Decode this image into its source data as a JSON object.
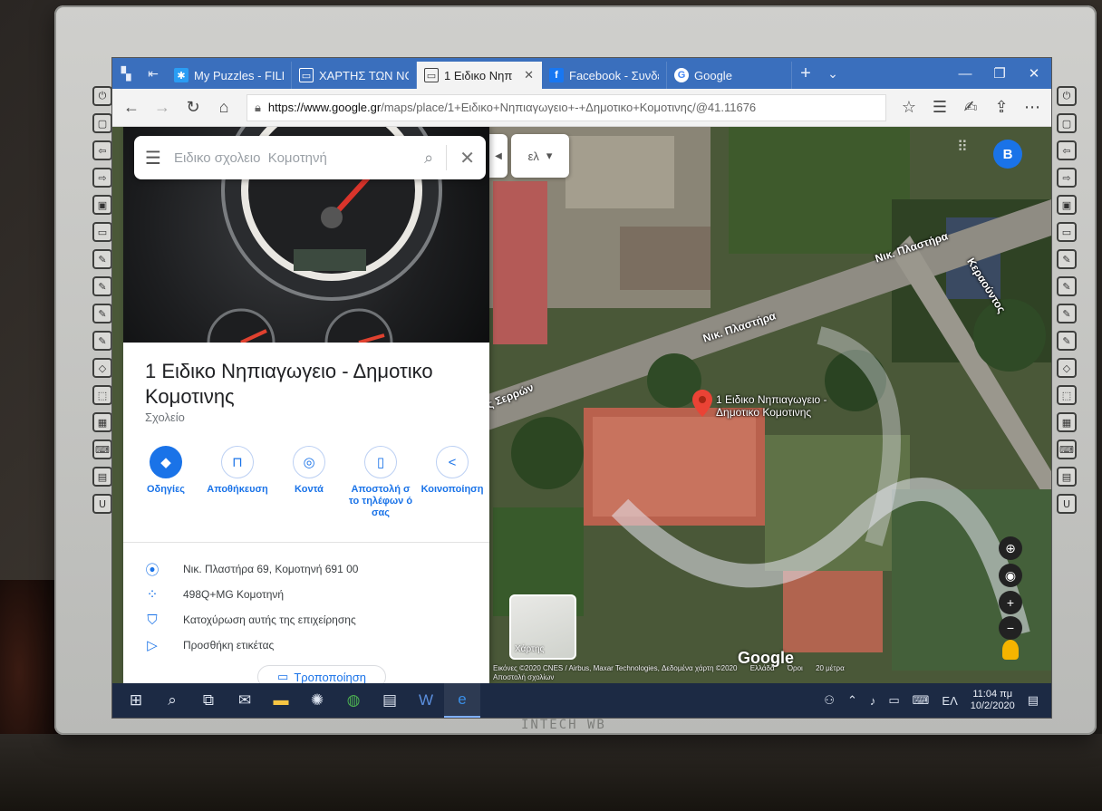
{
  "browser": {
    "tabs": [
      {
        "label": "My Puzzles - FILL",
        "icon": "puzzle-icon",
        "color": "#2a9df4",
        "active": false
      },
      {
        "label": "ΧΑΡΤΗΣ ΤΩΝ ΝΟ",
        "icon": "page-icon",
        "color": "#ffffff",
        "active": false
      },
      {
        "label": "1 Ειδικο Νηπ",
        "icon": "page-icon",
        "color": "#444444",
        "active": true
      },
      {
        "label": "Facebook - Συνδε",
        "icon": "facebook-icon",
        "color": "#1877f2",
        "active": false
      },
      {
        "label": "Google",
        "icon": "google-icon",
        "color": "#4285f4",
        "active": false
      }
    ],
    "url_host": "https://www.google.gr",
    "url_path": "/maps/place/1+Ειδικο+Νηπιαγωγειο+-+Δημοτικο+Κομοτινης/@41.11676"
  },
  "search": {
    "placeholder": "Ειδικο σχολειο  Κομοτηνή"
  },
  "place": {
    "title": "1 Ειδικο Νηπιαγωγειο - Δημοτικο Κομοτινης",
    "category": "Σχολείο",
    "actions": [
      {
        "label": "Οδηγίες",
        "icon": "directions-icon"
      },
      {
        "label": "Αποθήκευση",
        "icon": "bookmark-icon"
      },
      {
        "label": "Κοντά",
        "icon": "nearby-icon"
      },
      {
        "label": "Αποστολή σ το τηλέφων ό σας",
        "icon": "send-to-phone-icon"
      },
      {
        "label": "Κοινοποίηση",
        "icon": "share-icon"
      }
    ],
    "info": [
      {
        "text": "Νικ. Πλαστήρα 69, Κομοτηνή 691 00",
        "icon": "location-icon"
      },
      {
        "text": "498Q+MG Κομοτηνή",
        "icon": "plus-code-icon"
      },
      {
        "text": "Κατοχύρωση αυτής της επιχείρησης",
        "icon": "verified-icon"
      },
      {
        "text": "Προσθήκη ετικέτας",
        "icon": "label-icon"
      }
    ],
    "suggest_edit": "Τροποποίηση"
  },
  "map": {
    "lang_chip": "ελ",
    "avatar_letter": "B",
    "road_labels": [
      "Νικ. Πλαστήρα",
      "Νικ. Πλαστήρα",
      "ς Σερρών",
      "Κεραούντος"
    ],
    "pin_label": "1 Ειδικο Νηπιαγωγειο - Δημοτικο Κομοτινης",
    "layer_label": "Χάρτης",
    "google_logo": "Google",
    "attribution": "Εικόνες ©2020 CNES / Airbus, Maxar Technologies, Δεδομένα χάρτη ©2020",
    "attribution_region": "Ελλάδα",
    "attribution_terms": "Όροι",
    "scale_label": "20 μέτρα",
    "send_feedback": "Αποστολή σχολίων"
  },
  "taskbar": {
    "lang": "ΕΛ",
    "time": "11:04 πμ",
    "date": "10/2/2020"
  },
  "board": {
    "brand": "INTECH WB"
  }
}
